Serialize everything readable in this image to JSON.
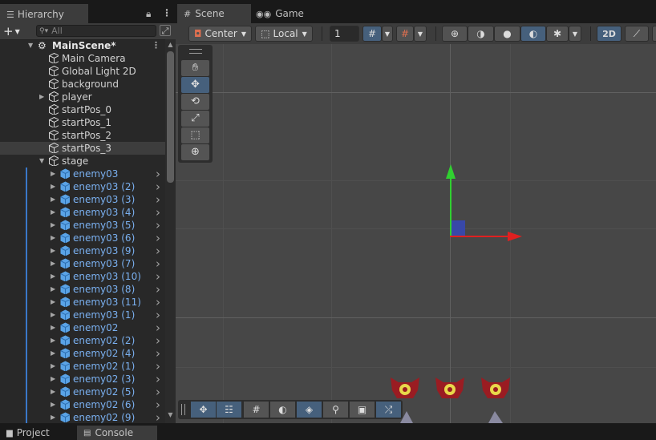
{
  "hierarchy": {
    "tab_title": "Hierarchy",
    "search_placeholder": "All",
    "scene_name": "MainScene*",
    "items": [
      {
        "label": "Main Camera",
        "depth": 1,
        "has_children": false,
        "prefab": false
      },
      {
        "label": "Global Light 2D",
        "depth": 1,
        "has_children": false,
        "prefab": false
      },
      {
        "label": "background",
        "depth": 1,
        "has_children": false,
        "prefab": false
      },
      {
        "label": "player",
        "depth": 1,
        "has_children": true,
        "prefab": false
      },
      {
        "label": "startPos_0",
        "depth": 1,
        "has_children": false,
        "prefab": false
      },
      {
        "label": "startPos_1",
        "depth": 1,
        "has_children": false,
        "prefab": false
      },
      {
        "label": "startPos_2",
        "depth": 1,
        "has_children": false,
        "prefab": false
      },
      {
        "label": "startPos_3",
        "depth": 1,
        "has_children": false,
        "prefab": false,
        "selected": true
      },
      {
        "label": "stage",
        "depth": 1,
        "has_children": true,
        "expanded": true,
        "prefab": false
      },
      {
        "label": "enemy03",
        "depth": 2,
        "has_children": true,
        "prefab": true
      },
      {
        "label": "enemy03 (2)",
        "depth": 2,
        "has_children": true,
        "prefab": true
      },
      {
        "label": "enemy03 (3)",
        "depth": 2,
        "has_children": true,
        "prefab": true
      },
      {
        "label": "enemy03 (4)",
        "depth": 2,
        "has_children": true,
        "prefab": true
      },
      {
        "label": "enemy03 (5)",
        "depth": 2,
        "has_children": true,
        "prefab": true
      },
      {
        "label": "enemy03 (6)",
        "depth": 2,
        "has_children": true,
        "prefab": true
      },
      {
        "label": "enemy03 (9)",
        "depth": 2,
        "has_children": true,
        "prefab": true
      },
      {
        "label": "enemy03 (7)",
        "depth": 2,
        "has_children": true,
        "prefab": true
      },
      {
        "label": "enemy03 (10)",
        "depth": 2,
        "has_children": true,
        "prefab": true
      },
      {
        "label": "enemy03 (8)",
        "depth": 2,
        "has_children": true,
        "prefab": true
      },
      {
        "label": "enemy03 (11)",
        "depth": 2,
        "has_children": true,
        "prefab": true
      },
      {
        "label": "enemy03 (1)",
        "depth": 2,
        "has_children": true,
        "prefab": true
      },
      {
        "label": "enemy02",
        "depth": 2,
        "has_children": true,
        "prefab": true
      },
      {
        "label": "enemy02 (2)",
        "depth": 2,
        "has_children": true,
        "prefab": true
      },
      {
        "label": "enemy02 (4)",
        "depth": 2,
        "has_children": true,
        "prefab": true
      },
      {
        "label": "enemy02 (1)",
        "depth": 2,
        "has_children": true,
        "prefab": true
      },
      {
        "label": "enemy02 (3)",
        "depth": 2,
        "has_children": true,
        "prefab": true
      },
      {
        "label": "enemy02 (5)",
        "depth": 2,
        "has_children": true,
        "prefab": true
      },
      {
        "label": "enemy02 (6)",
        "depth": 2,
        "has_children": true,
        "prefab": true
      },
      {
        "label": "enemy02 (9)",
        "depth": 2,
        "has_children": true,
        "prefab": true
      }
    ]
  },
  "scene": {
    "tab_scene": "Scene",
    "tab_game": "Game",
    "pivot_mode": "Center",
    "pivot_rotation": "Local",
    "grid_value": "1",
    "mode_2d": "2D"
  },
  "bottom": {
    "tab_project": "Project",
    "tab_console": "Console"
  },
  "colors": {
    "prefab_text": "#7ab0f0",
    "prefab_icon": "#5aa3e6",
    "accent": "#46607c",
    "axis_x": "#e02020",
    "axis_y": "#30d030"
  }
}
